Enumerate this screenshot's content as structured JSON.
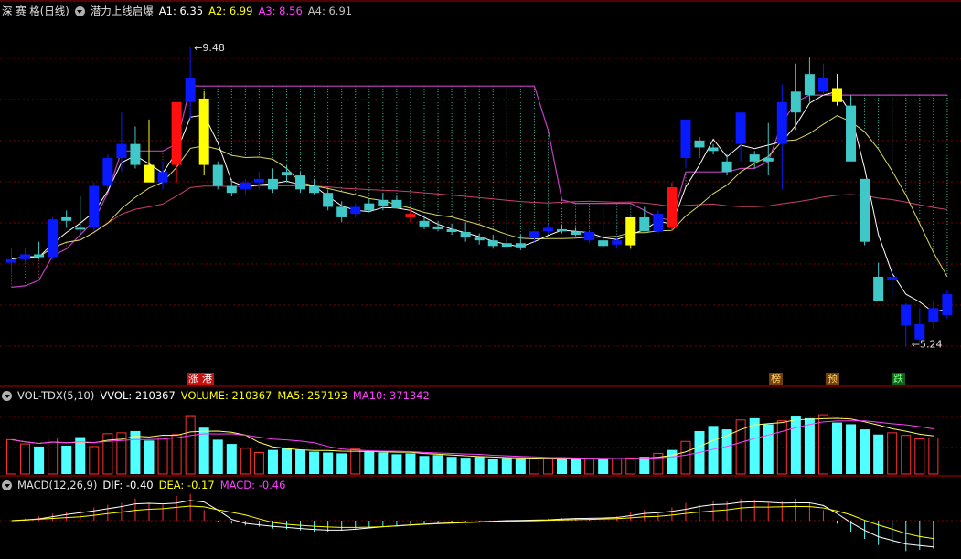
{
  "header": {
    "stock_name": "深 赛 格(日线)",
    "indicator_name": "潜力上线启爆",
    "a1": "A1: 6.35",
    "a2": "A2: 6.99",
    "a3": "A3: 8.56",
    "a4": "A4: 6.91"
  },
  "volume_header": {
    "name": "VOL-TDX(5,10)",
    "vvol": "VVOL: 210367",
    "volume": "VOLUME: 210367",
    "ma5": "MA5: 257193",
    "ma10": "MA10: 371342"
  },
  "macd_header": {
    "name": "MACD(12,26,9)",
    "dif": "DIF: -0.40",
    "dea": "DEA: -0.17",
    "macd": "MACD: -0.46"
  },
  "markers": {
    "zhang": "涨",
    "gang": "港",
    "bang": "榜",
    "yu": "预",
    "die": "跌"
  },
  "colors": {
    "background": "#000000",
    "grid": "#800000",
    "up_blue": "#0a1aff",
    "down_cyan": "#40c8c8",
    "red_bar": "#ff1010",
    "yellow_bar": "#ffff00",
    "band_line": "#c040c0",
    "ma_white": "#ffffff",
    "ma_yellow": "#d8d860",
    "long_ma": "#c84070",
    "vol_up": "#ff3030",
    "vol_down": "#50ffff",
    "macd_pos": "#ff3030",
    "macd_neg": "#50ffff",
    "dif_line": "#ffffff",
    "dea_line": "#ffff00"
  },
  "chart_data": [
    {
      "type": "candlestick",
      "title": "潜力上线启爆",
      "x": [
        1,
        2,
        3,
        4,
        5,
        6,
        7,
        8,
        9,
        10,
        11,
        12,
        13,
        14,
        15,
        16,
        17,
        18,
        19,
        20,
        21,
        22,
        23,
        24,
        25,
        26,
        27,
        28,
        29,
        30,
        31,
        32,
        33,
        34,
        35,
        36,
        37,
        38,
        39,
        40,
        41,
        42,
        43,
        44,
        45,
        46,
        47,
        48,
        49,
        50,
        51,
        52,
        53,
        54,
        55,
        56,
        57,
        58,
        59,
        60,
        61,
        62,
        63,
        64,
        65,
        66,
        67,
        68
      ],
      "ohlc": [
        [
          6.4,
          6.6,
          6.25,
          6.45
        ],
        [
          6.45,
          6.62,
          6.38,
          6.52
        ],
        [
          6.52,
          6.7,
          6.45,
          6.48
        ],
        [
          6.48,
          7.05,
          6.45,
          7.02
        ],
        [
          7.05,
          7.15,
          6.9,
          7.0
        ],
        [
          6.9,
          7.35,
          6.8,
          6.88
        ],
        [
          6.9,
          7.55,
          6.85,
          7.5
        ],
        [
          7.5,
          7.95,
          7.45,
          7.9
        ],
        [
          7.9,
          8.55,
          7.7,
          8.1
        ],
        [
          8.1,
          8.35,
          7.75,
          7.8
        ],
        [
          7.8,
          8.45,
          7.7,
          7.55
        ],
        [
          7.55,
          7.85,
          7.45,
          7.7
        ],
        [
          7.8,
          8.65,
          7.55,
          8.7
        ],
        [
          8.7,
          9.48,
          8.45,
          9.05
        ],
        [
          8.75,
          8.85,
          7.65,
          7.8
        ],
        [
          7.8,
          7.85,
          7.45,
          7.5
        ],
        [
          7.5,
          7.6,
          7.35,
          7.4
        ],
        [
          7.45,
          7.6,
          7.38,
          7.55
        ],
        [
          7.55,
          7.7,
          7.45,
          7.6
        ],
        [
          7.6,
          7.75,
          7.4,
          7.45
        ],
        [
          7.7,
          7.8,
          7.55,
          7.65
        ],
        [
          7.65,
          7.7,
          7.4,
          7.45
        ],
        [
          7.5,
          7.6,
          7.38,
          7.4
        ],
        [
          7.4,
          7.45,
          7.15,
          7.2
        ],
        [
          7.2,
          7.28,
          6.98,
          7.05
        ],
        [
          7.1,
          7.25,
          7.05,
          7.2
        ],
        [
          7.25,
          7.32,
          7.12,
          7.15
        ],
        [
          7.3,
          7.4,
          7.15,
          7.22
        ],
        [
          7.3,
          7.35,
          7.2,
          7.18
        ],
        [
          7.1,
          7.18,
          6.98,
          7.05
        ],
        [
          7.0,
          7.08,
          6.88,
          6.92
        ],
        [
          6.92,
          7.0,
          6.85,
          6.88
        ],
        [
          6.88,
          6.96,
          6.8,
          6.84
        ],
        [
          6.84,
          6.98,
          6.7,
          6.76
        ],
        [
          6.76,
          6.82,
          6.66,
          6.72
        ],
        [
          6.72,
          6.8,
          6.6,
          6.64
        ],
        [
          6.68,
          6.78,
          6.6,
          6.63
        ],
        [
          6.68,
          6.8,
          6.58,
          6.62
        ],
        [
          6.75,
          6.85,
          6.7,
          6.85
        ],
        [
          6.85,
          6.95,
          6.82,
          6.9
        ],
        [
          6.88,
          6.95,
          6.82,
          6.85
        ],
        [
          6.85,
          6.9,
          6.78,
          6.8
        ],
        [
          6.72,
          6.82,
          6.68,
          6.84
        ],
        [
          6.72,
          6.8,
          6.6,
          6.64
        ],
        [
          6.66,
          6.78,
          6.6,
          6.72
        ],
        [
          6.65,
          6.95,
          6.6,
          7.05
        ],
        [
          7.05,
          7.2,
          6.85,
          6.85
        ],
        [
          6.85,
          7.15,
          6.82,
          7.1
        ],
        [
          7.48,
          7.55,
          6.85,
          6.9
        ],
        [
          7.9,
          8.25,
          7.75,
          8.45
        ],
        [
          8.15,
          8.2,
          7.9,
          8.05
        ],
        [
          8.05,
          8.1,
          7.95,
          8.0
        ],
        [
          7.85,
          7.95,
          7.65,
          7.7
        ],
        [
          8.1,
          8.3,
          7.85,
          8.55
        ],
        [
          7.95,
          8.0,
          7.75,
          7.85
        ],
        [
          7.9,
          8.4,
          7.65,
          7.85
        ],
        [
          8.1,
          8.95,
          7.45,
          8.7
        ],
        [
          8.85,
          9.25,
          8.3,
          8.55
        ],
        [
          9.1,
          9.35,
          8.7,
          8.8
        ],
        [
          8.85,
          9.25,
          8.8,
          9.05
        ],
        [
          8.9,
          9.1,
          8.65,
          8.7
        ],
        [
          8.65,
          8.8,
          7.95,
          7.85
        ],
        [
          7.6,
          7.6,
          6.65,
          6.7
        ],
        [
          6.2,
          6.4,
          5.85,
          5.85
        ],
        [
          6.15,
          6.35,
          5.9,
          6.2
        ],
        [
          5.5,
          5.82,
          5.2,
          5.8
        ],
        [
          5.3,
          5.75,
          5.24,
          5.52
        ],
        [
          5.55,
          5.85,
          5.45,
          5.75
        ],
        [
          5.65,
          6.0,
          5.6,
          5.95
        ]
      ],
      "yrange": [
        4.8,
        9.9
      ],
      "annotations": [
        "9.48",
        "5.24"
      ],
      "series_lines": [
        "band_upper",
        "ma_fast",
        "ma_slow",
        "long_ma"
      ]
    },
    {
      "type": "bar",
      "title": "VOL-TDX(5,10)",
      "values": [
        200,
        175,
        160,
        210,
        165,
        215,
        160,
        235,
        240,
        250,
        195,
        210,
        230,
        340,
        270,
        200,
        175,
        150,
        125,
        140,
        150,
        140,
        130,
        125,
        120,
        145,
        130,
        125,
        115,
        120,
        105,
        110,
        100,
        95,
        100,
        90,
        95,
        92,
        88,
        90,
        95,
        92,
        90,
        85,
        90,
        94,
        100,
        120,
        140,
        190,
        250,
        280,
        260,
        315,
        325,
        290,
        310,
        340,
        325,
        345,
        300,
        290,
        260,
        230,
        240,
        225,
        205,
        210
      ],
      "ylim": [
        0,
        420
      ]
    },
    {
      "type": "bar",
      "title": "MACD(12,26,9)",
      "values": [
        0.0,
        0.02,
        0.05,
        0.08,
        0.1,
        0.12,
        0.15,
        0.18,
        0.2,
        0.25,
        0.2,
        0.18,
        0.28,
        0.3,
        0.12,
        -0.02,
        -0.05,
        -0.08,
        -0.1,
        -0.13,
        -0.14,
        -0.16,
        -0.18,
        -0.18,
        -0.16,
        -0.13,
        -0.11,
        -0.09,
        -0.08,
        -0.06,
        -0.05,
        -0.04,
        -0.03,
        -0.02,
        -0.01,
        0.0,
        0.01,
        0.0,
        0.01,
        0.02,
        0.03,
        0.03,
        0.03,
        0.04,
        0.05,
        0.1,
        0.12,
        0.08,
        0.15,
        0.2,
        0.18,
        0.22,
        0.22,
        0.25,
        0.24,
        0.2,
        0.22,
        0.25,
        0.2,
        0.12,
        -0.05,
        -0.18,
        -0.3,
        -0.4,
        -0.38,
        -0.5,
        -0.48,
        -0.46
      ],
      "ylim": [
        -0.6,
        0.35
      ]
    }
  ]
}
